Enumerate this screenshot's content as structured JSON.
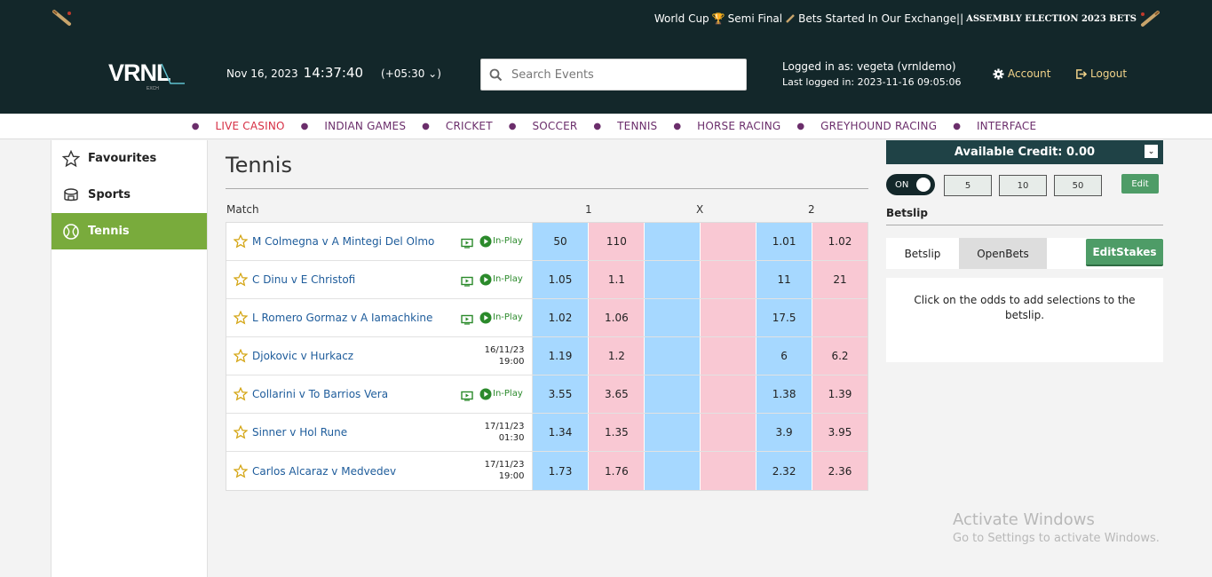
{
  "ticker": {
    "world_cup": "World Cup",
    "semi_final": "Semi Final",
    "bets_started": "Bets Started In Our Exchange||",
    "assembly": "ASSEMBLY ELECTION 2023 BETS"
  },
  "header": {
    "logo_text": "VRNL",
    "logo_sub": "EXCH",
    "date": "Nov 16, 2023",
    "time": "14:37:40",
    "timezone": "(+05:30 ⌄)",
    "search_placeholder": "Search Events",
    "logged_in": "Logged in as: vegeta (vrnldemo)",
    "last_logged": "Last logged in: 2023-11-16 09:05:06",
    "account": "Account",
    "logout": "Logout"
  },
  "nav": [
    "LIVE CASINO",
    "INDIAN GAMES",
    "CRICKET",
    "SOCCER",
    "TENNIS",
    "HORSE RACING",
    "GREYHOUND RACING",
    "INTERFACE"
  ],
  "sidebar": {
    "favourites": "Favourites",
    "sports": "Sports",
    "tennis": "Tennis"
  },
  "main": {
    "title": "Tennis",
    "col_match": "Match",
    "col_1": "1",
    "col_x": "X",
    "col_2": "2",
    "inplay_label": "In-Play",
    "matches": [
      {
        "name": "M Colmegna v A Mintegi Del Olmo",
        "date": "",
        "time": "",
        "b1": "50",
        "l1": "110",
        "bx": "",
        "lx": "",
        "b2": "1.01",
        "l2": "1.02"
      },
      {
        "name": "C Dinu v E Christofi",
        "date": "",
        "time": "",
        "b1": "1.05",
        "l1": "1.1",
        "bx": "",
        "lx": "",
        "b2": "11",
        "l2": "21"
      },
      {
        "name": "L Romero Gormaz v A Iamachkine",
        "date": "",
        "time": "",
        "b1": "1.02",
        "l1": "1.06",
        "bx": "",
        "lx": "",
        "b2": "17.5",
        "l2": ""
      },
      {
        "name": "Djokovic v Hurkacz",
        "date": "16/11/23",
        "time": "19:00",
        "b1": "1.19",
        "l1": "1.2",
        "bx": "",
        "lx": "",
        "b2": "6",
        "l2": "6.2"
      },
      {
        "name": "Collarini v To Barrios Vera",
        "date": "",
        "time": "",
        "b1": "3.55",
        "l1": "3.65",
        "bx": "",
        "lx": "",
        "b2": "1.38",
        "l2": "1.39"
      },
      {
        "name": "Sinner v Hol Rune",
        "date": "17/11/23",
        "time": "01:30",
        "b1": "1.34",
        "l1": "1.35",
        "bx": "",
        "lx": "",
        "b2": "3.9",
        "l2": "3.95"
      },
      {
        "name": "Carlos Alcaraz v Medvedev",
        "date": "17/11/23",
        "time": "19:00",
        "b1": "1.73",
        "l1": "1.76",
        "bx": "",
        "lx": "",
        "b2": "2.32",
        "l2": "2.36"
      }
    ]
  },
  "betslip": {
    "credit": "Available Credit: 0.00",
    "toggle": "ON",
    "stakes": [
      "5",
      "10",
      "50"
    ],
    "edit": "Edit",
    "title": "Betslip",
    "tab_betslip": "Betslip",
    "tab_openbets": "OpenBets",
    "edit_stakes": "EditStakes",
    "empty_msg": "Click on the odds to add selections to the betslip."
  },
  "watermark": {
    "line1": "Activate Windows",
    "line2": "Go to Settings to activate Windows."
  },
  "colors": {
    "header_bg": "#13272a",
    "back": "#a6d8ff",
    "lay": "#f9c8d3",
    "active_green": "#79ab3c",
    "nav_purple": "#6b2e6b",
    "nav_red": "#d62f44"
  }
}
